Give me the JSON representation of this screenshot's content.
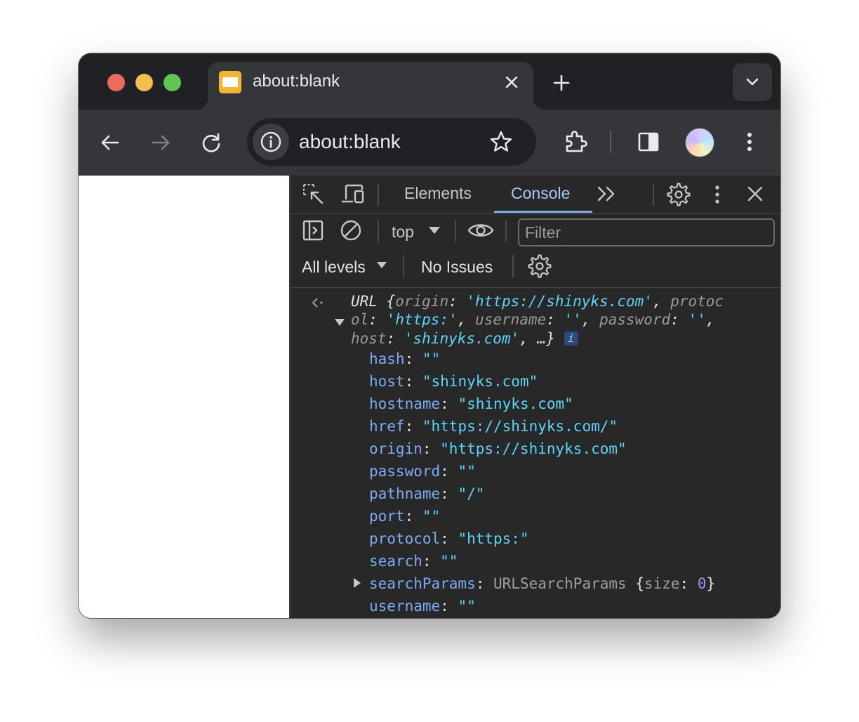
{
  "browser": {
    "tab": {
      "title": "about:blank"
    },
    "omnibox": {
      "url": "about:blank"
    }
  },
  "devtools": {
    "tabs": [
      {
        "label": "Elements"
      },
      {
        "label": "Console"
      }
    ],
    "context": "top",
    "filter_placeholder": "Filter",
    "levels_label": "All levels",
    "issues_label": "No Issues"
  },
  "console": {
    "summary": {
      "class_name": "URL",
      "origin_key": "origin",
      "origin_val": "'https://shinyks.com'",
      "protocol_key_a": "protoc",
      "protocol_key_b": "ol",
      "protocol_val": "'https:'",
      "username_key": "username",
      "username_val": "''",
      "password_key": "password",
      "password_val": "''",
      "host_key": "host",
      "host_val": "'shinyks.com'",
      "ellipsis": "…}",
      "info": "i"
    },
    "props": [
      {
        "key": "hash",
        "val": "\"\""
      },
      {
        "key": "host",
        "val": "\"shinyks.com\""
      },
      {
        "key": "hostname",
        "val": "\"shinyks.com\""
      },
      {
        "key": "href",
        "val": "\"https://shinyks.com/\""
      },
      {
        "key": "origin",
        "val": "\"https://shinyks.com\""
      },
      {
        "key": "password",
        "val": "\"\""
      },
      {
        "key": "pathname",
        "val": "\"/\""
      },
      {
        "key": "port",
        "val": "\"\""
      },
      {
        "key": "protocol",
        "val": "\"https:\""
      },
      {
        "key": "search",
        "val": "\"\""
      },
      {
        "key": "searchParams",
        "type": "URLSearchParams",
        "inner_key": "size",
        "inner_val": "0"
      },
      {
        "key": "username",
        "val": "\"\""
      }
    ]
  }
}
